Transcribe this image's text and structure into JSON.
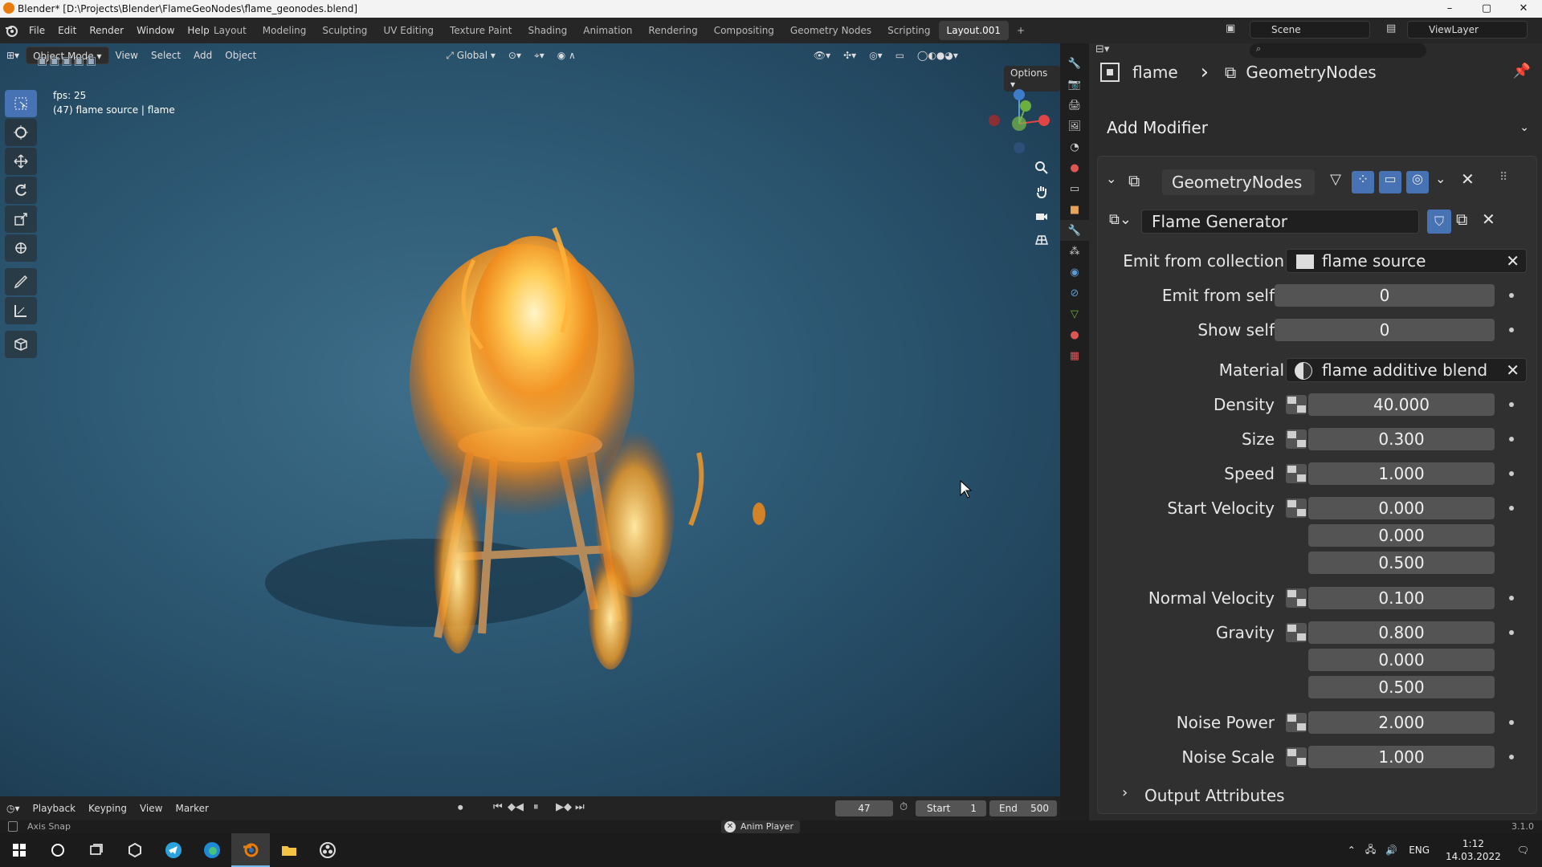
{
  "window": {
    "title": "Blender* [D:\\Projects\\Blender\\FlameGeoNodes\\flame_geonodes.blend]",
    "minimize": "–",
    "maximize": "▢",
    "close": "✕"
  },
  "menu": {
    "items": [
      "File",
      "Edit",
      "Render",
      "Window",
      "Help"
    ]
  },
  "workspaces": {
    "tabs": [
      "Layout",
      "Modeling",
      "Sculpting",
      "UV Editing",
      "Texture Paint",
      "Shading",
      "Animation",
      "Rendering",
      "Compositing",
      "Geometry Nodes",
      "Scripting",
      "Layout.001"
    ],
    "add": "+"
  },
  "scene": {
    "label": "Scene",
    "view_layer": "ViewLayer"
  },
  "viewport": {
    "mode": "Object Mode",
    "menus": [
      "View",
      "Select",
      "Add",
      "Object"
    ],
    "orientation": "Global",
    "options": "Options",
    "fps": "fps: 25",
    "info": "(47) flame source | flame"
  },
  "timeline": {
    "menus": [
      "Playback",
      "Keyping",
      "View",
      "Marker"
    ],
    "current_frame": "47",
    "start_label": "Start",
    "start": "1",
    "end_label": "End",
    "end": "500"
  },
  "status": {
    "left": "Axis Snap",
    "center": "Anim Player",
    "version": "3.1.0"
  },
  "properties": {
    "object": "flame",
    "breadcrumb_sep": "›",
    "modifier_name": "GeometryNodes",
    "add_modifier": "Add Modifier",
    "panel_title": "GeometryNodes",
    "node_group": "Flame Generator",
    "fields": {
      "emit_collection_label": "Emit from collection",
      "emit_collection_value": "flame source",
      "emit_self_label": "Emit from self",
      "emit_self_value": "0",
      "show_self_label": "Show self",
      "show_self_value": "0",
      "material_label": "Material",
      "material_value": "flame additive blend",
      "density_label": "Density",
      "density_value": "40.000",
      "size_label": "Size",
      "size_value": "0.300",
      "speed_label": "Speed",
      "speed_value": "1.000",
      "start_velocity_label": "Start Velocity",
      "start_velocity": [
        "0.000",
        "0.000",
        "0.500"
      ],
      "normal_velocity_label": "Normal Velocity",
      "normal_velocity_value": "0.100",
      "gravity_label": "Gravity",
      "gravity": [
        "0.800",
        "0.000",
        "0.500"
      ],
      "noise_power_label": "Noise Power",
      "noise_power_value": "2.000",
      "noise_scale_label": "Noise Scale",
      "noise_scale_value": "1.000"
    },
    "output_attributes": "Output Attributes"
  },
  "taskbar": {
    "lang": "ENG",
    "time": "1:12",
    "date": "14.03.2022"
  },
  "colors": {
    "accent": "#4772b3",
    "blender_orange": "#e87d0d",
    "flame": "#ffb23a"
  }
}
